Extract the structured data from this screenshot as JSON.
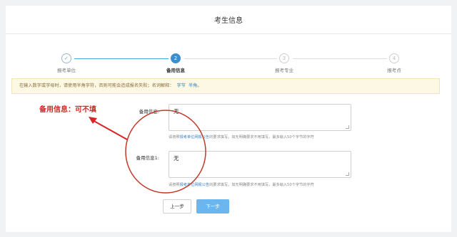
{
  "header": {
    "title": "考生信息"
  },
  "steps": [
    {
      "label": "报考单位",
      "marker": "✓",
      "state": "done"
    },
    {
      "label": "备用信息",
      "marker": "2",
      "state": "active"
    },
    {
      "label": "报考专业",
      "marker": "3",
      "state": "idle"
    },
    {
      "label": "报考点",
      "marker": "4",
      "state": "idle"
    }
  ],
  "notice": {
    "text": "在输入数字或字母时，请使用半角字符，否则可能会造成报名失败；名词解释：",
    "link1": "字节",
    "link2": "半角",
    "suffix": "。"
  },
  "form": {
    "field1": {
      "label": "备用信息:",
      "value": "无",
      "hint_prefix": "请按照",
      "hint_link": "报考单位网报公告",
      "hint_suffix": "的要求填写。如无明确要求不用填写。最多输入50个字节的字符"
    },
    "field2": {
      "label": "备用信息1:",
      "value": "无",
      "hint_prefix": "请按照",
      "hint_link": "报考单位网报公告",
      "hint_suffix": "的要求填写。如无明确要求不用填写。最多输入50个字节的字符"
    }
  },
  "buttons": {
    "prev": "上一步",
    "next": "下一步"
  },
  "annotation": {
    "text": "备用信息：可不填",
    "color": "#d72424"
  },
  "colors": {
    "accent": "#3a8fd0",
    "button_primary": "#6bb6ef",
    "notice_bg": "#fcf8e3",
    "annotation": "#d72424"
  }
}
